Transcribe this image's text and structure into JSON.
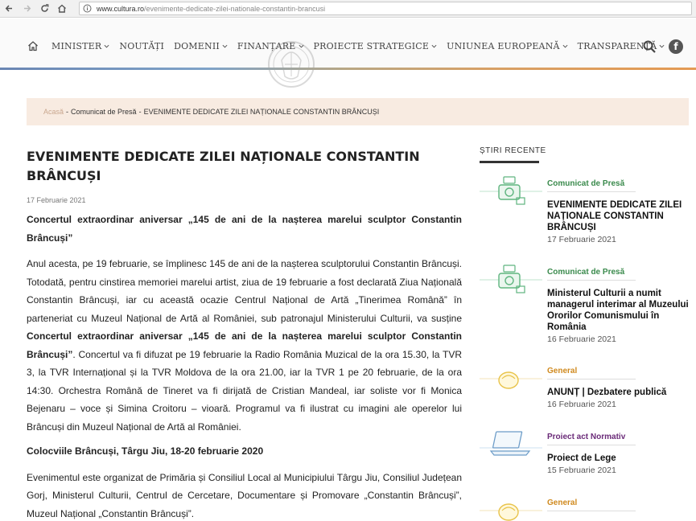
{
  "browser": {
    "url_host": "www.cultura.ro",
    "url_path": "/evenimente-dedicate-zilei-nationale-constantin-brancusi"
  },
  "nav": {
    "items": [
      {
        "label": "MINISTER",
        "has_dropdown": true
      },
      {
        "label": "NOUTĂȚI",
        "has_dropdown": false
      },
      {
        "label": "DOMENII",
        "has_dropdown": true
      },
      {
        "label": "FINANȚARE",
        "has_dropdown": true
      },
      {
        "label": "PROIECTE STRATEGICE",
        "has_dropdown": true
      },
      {
        "label": "UNIUNEA EUROPEANĂ",
        "has_dropdown": true
      },
      {
        "label": "TRANSPARENȚĂ",
        "has_dropdown": true
      }
    ],
    "facebook_glyph": "f"
  },
  "colors": {
    "breadcrumb_bg": "#f8ebe1",
    "cat_press": "#3a8a4c",
    "cat_general": "#d08a1f",
    "cat_normativ": "#6a2a78"
  },
  "breadcrumb": {
    "home": "Acasă",
    "section": "Comunicat de Presă",
    "current": "EVENIMENTE DEDICATE ZILEI NAȚIONALE CONSTANTIN BRÂNCUȘI"
  },
  "article": {
    "title": "EVENIMENTE DEDICATE ZILEI NAȚIONALE CONSTANTIN BRÂNCUȘI",
    "date": "17 Februarie 2021",
    "lead": "Concertul extraordinar aniversar „145 de ani de la nașterea marelui sculptor Constantin Brâncuși”",
    "p1_a": "Anul acesta, pe 19 februarie, se împlinesc 145 de ani de la nașterea sculptorului Constantin Brâncuși. Totodată, pentru cinstirea memoriei marelui artist, ziua de 19 februarie a fost declarată Ziua Națională Constantin Brâncuși, iar cu această ocazie Centrul Național de Artă „Tinerimea Română” în parteneriat cu Muzeul Național de Artă al României, sub patronajul Ministerului Culturii, va susține ",
    "p1_bold": "Concertul extraordinar aniversar „145 de ani de la nașterea marelui sculptor Constantin Brâncuși”",
    "p1_b": ". Concertul va fi difuzat pe 19 februarie la Radio România Muzical de la ora 15.30, la TVR 3, la TVR Internațional și la TVR Moldova de la ora 21.00, iar la TVR 1 pe 20 februarie, de la ora 14:30. Orchestra Română de Tineret va fi dirijată de Cristian Mandeal, iar soliste vor fi Monica Bejenaru – voce și Simina Croitoru – vioară. Programul va fi ilustrat cu imagini ale operelor lui Brâncuși din Muzeul Național de Artă al României.",
    "subhead": "Colocviile Brâncuși, Târgu Jiu, 18-20 februarie 2020",
    "p2": "Evenimentul este organizat de Primăria și Consiliul Local al Municipiului Târgu Jiu, Consiliul Județean Gorj, Ministerul Culturii, Centrul de Cercetare, Documentare și Promovare „Constantin Brâncuși”, Muzeul Național „Constantin Brâncuși”."
  },
  "sidebar": {
    "title": "ȘTIRI RECENTE",
    "news": [
      {
        "category": "Comunicat de Presă",
        "title": "EVENIMENTE DEDICATE ZILEI NAȚIONALE CONSTANTIN BRÂNCUȘI",
        "date": "17 Februarie 2021"
      },
      {
        "category": "Comunicat de Presă",
        "title": "Ministerul Culturii a numit managerul interimar al Muzeului Ororilor Comunismului în România",
        "date": "16 Februarie 2021"
      },
      {
        "category": "General",
        "title": "ANUNȚ | Dezbatere publică",
        "date": "16 Februarie 2021"
      },
      {
        "category": "Proiect act Normativ",
        "title": "Proiect de Lege",
        "date": "15 Februarie 2021"
      },
      {
        "category": "General",
        "title": "",
        "date": ""
      }
    ]
  }
}
